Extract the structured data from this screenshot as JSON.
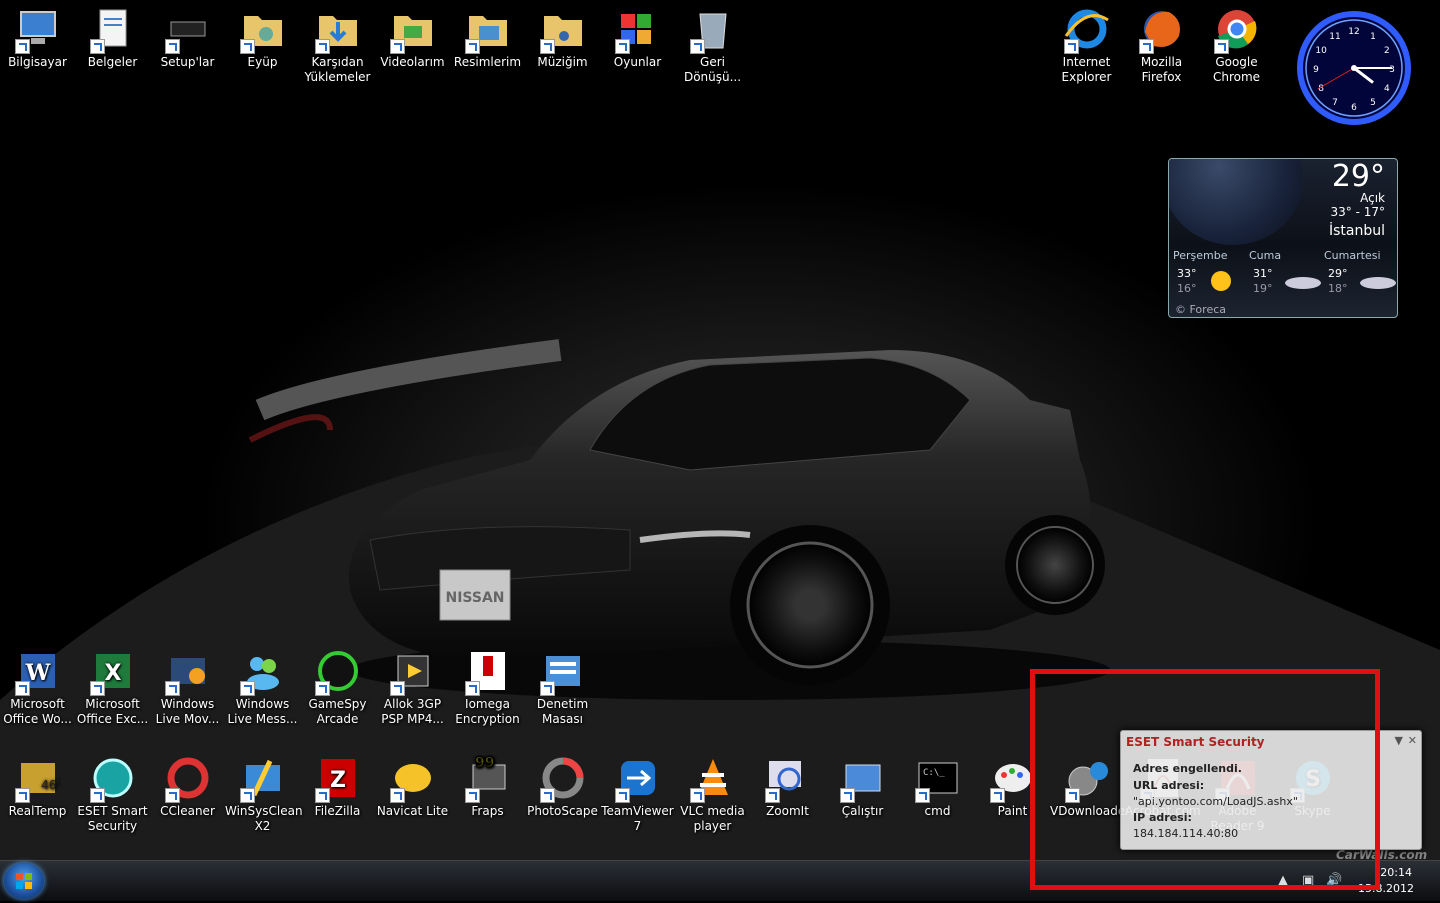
{
  "desktop": {
    "top_icons": [
      {
        "label": "Bilgisayar",
        "icon": "computer-icon"
      },
      {
        "label": "Belgeler",
        "icon": "documents-icon"
      },
      {
        "label": "Setup'lar",
        "icon": "chip-icon"
      },
      {
        "label": "Eyüp",
        "icon": "user-folder-icon"
      },
      {
        "label": "Karşıdan\nYüklemeler",
        "icon": "downloads-folder-icon"
      },
      {
        "label": "Videolarım",
        "icon": "videos-folder-icon"
      },
      {
        "label": "Resimlerim",
        "icon": "pictures-folder-icon"
      },
      {
        "label": "Müziğim",
        "icon": "music-folder-icon"
      },
      {
        "label": "Oyunlar",
        "icon": "games-icon"
      },
      {
        "label": "Geri\nDönüşü...",
        "icon": "recycle-bin-icon"
      }
    ],
    "browser_icons": [
      {
        "label": "Internet\nExplorer",
        "icon": "internet-explorer-icon"
      },
      {
        "label": "Mozilla\nFirefox",
        "icon": "firefox-icon"
      },
      {
        "label": "Google\nChrome",
        "icon": "chrome-icon"
      }
    ],
    "row2_icons": [
      {
        "label": "Microsoft\nOffice Wo...",
        "icon": "word-icon"
      },
      {
        "label": "Microsoft\nOffice Exc...",
        "icon": "excel-icon"
      },
      {
        "label": "Windows\nLive Mov...",
        "icon": "movie-maker-icon"
      },
      {
        "label": "Windows\nLive Mess...",
        "icon": "messenger-icon"
      },
      {
        "label": "GameSpy\nArcade",
        "icon": "gamespy-icon"
      },
      {
        "label": "Allok 3GP\nPSP MP4...",
        "icon": "video-converter-icon"
      },
      {
        "label": "Iomega\nEncryption",
        "icon": "iomega-icon"
      },
      {
        "label": "Denetim\nMasası",
        "icon": "control-panel-icon"
      }
    ],
    "row3_icons": [
      {
        "label": "RealTemp",
        "icon": "realtemp-icon"
      },
      {
        "label": "ESET Smart\nSecurity",
        "icon": "eset-icon"
      },
      {
        "label": "CCleaner",
        "icon": "ccleaner-icon"
      },
      {
        "label": "WinSysClean\nX2",
        "icon": "winsysclean-icon"
      },
      {
        "label": "FileZilla",
        "icon": "filezilla-icon"
      },
      {
        "label": "Navicat Lite",
        "icon": "navicat-icon"
      },
      {
        "label": "Fraps",
        "icon": "fraps-icon"
      },
      {
        "label": "PhotoScape",
        "icon": "photoscape-icon"
      },
      {
        "label": "TeamViewer\n7",
        "icon": "teamviewer-icon"
      },
      {
        "label": "VLC media\nplayer",
        "icon": "vlc-icon"
      },
      {
        "label": "ZoomIt",
        "icon": "zoomit-icon"
      },
      {
        "label": "Çalıştır",
        "icon": "run-icon"
      },
      {
        "label": "cmd",
        "icon": "cmd-icon"
      },
      {
        "label": "Paint",
        "icon": "paint-icon"
      },
      {
        "label": "VDownloader",
        "icon": "vdownloader-icon"
      },
      {
        "label": "Acrobat.com",
        "icon": "acrobat-com-icon"
      },
      {
        "label": "Adobe\nReader 9",
        "icon": "adobe-reader-icon"
      },
      {
        "label": "Skype",
        "icon": "skype-icon"
      }
    ]
  },
  "weather": {
    "temp": "29°",
    "condition": "Açık",
    "range": "33° - 17°",
    "city": "İstanbul",
    "forecast": [
      {
        "day": "Perşembe",
        "hi": "33°",
        "lo": "16°",
        "icon": "sun-icon"
      },
      {
        "day": "Cuma",
        "hi": "31°",
        "lo": "19°",
        "icon": "cloud-icon"
      },
      {
        "day": "Cumartesi",
        "hi": "29°",
        "lo": "18°",
        "icon": "cloud-icon"
      }
    ],
    "credit": "© Foreca"
  },
  "clock": {
    "hour": 4,
    "minute": 15,
    "second": 40
  },
  "notification": {
    "title": "ESET Smart Security",
    "line1": "Adres engellendi.",
    "line2": "URL adresi:",
    "line3": "\"api.yontoo.com/LoadJS.ashx\"",
    "line4": "IP adresi:",
    "line5": "184.184.114.40:80"
  },
  "tray": {
    "time": "20:14",
    "date": "15.8.2012"
  },
  "watermark": "CarWalls.com",
  "car_badge": "NISSAN",
  "colors": {
    "highlight": "#e01010",
    "eset_title": "#b02323"
  }
}
